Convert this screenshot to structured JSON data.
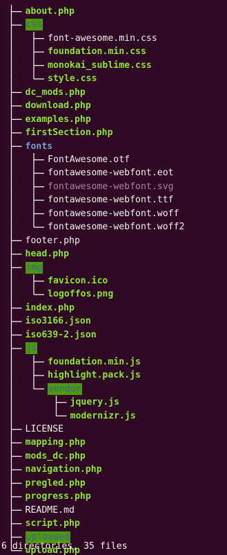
{
  "terminal": {
    "summary": "6 directories, 35 files",
    "colors": {
      "background": "#300a24",
      "executable": "#8ae234",
      "directory": "#729fcf",
      "directory_highlight_bg": "#4e9a06",
      "directory_highlight_fg": "#3465a4",
      "plain": "#eeeeec",
      "image_like": "#ad7fa8",
      "tree_lines": "#eeeeec"
    },
    "entries": [
      {
        "name": "about.php",
        "depth": 0,
        "style": "green",
        "last": false,
        "ancestors_last": []
      },
      {
        "name": "css",
        "depth": 0,
        "style": "dir-hl",
        "last": false,
        "ancestors_last": []
      },
      {
        "name": "font-awesome.min.css",
        "depth": 1,
        "style": "white",
        "last": false,
        "ancestors_last": [
          false
        ]
      },
      {
        "name": "foundation.min.css",
        "depth": 1,
        "style": "green",
        "last": false,
        "ancestors_last": [
          false
        ]
      },
      {
        "name": "monokai_sublime.css",
        "depth": 1,
        "style": "green",
        "last": false,
        "ancestors_last": [
          false
        ]
      },
      {
        "name": "style.css",
        "depth": 1,
        "style": "green",
        "last": true,
        "ancestors_last": [
          false
        ]
      },
      {
        "name": "dc_mods.php",
        "depth": 0,
        "style": "green",
        "last": false,
        "ancestors_last": []
      },
      {
        "name": "download.php",
        "depth": 0,
        "style": "green",
        "last": false,
        "ancestors_last": []
      },
      {
        "name": "examples.php",
        "depth": 0,
        "style": "green",
        "last": false,
        "ancestors_last": []
      },
      {
        "name": "firstSection.php",
        "depth": 0,
        "style": "green",
        "last": false,
        "ancestors_last": []
      },
      {
        "name": "fonts",
        "depth": 0,
        "style": "dir",
        "last": false,
        "ancestors_last": []
      },
      {
        "name": "FontAwesome.otf",
        "depth": 1,
        "style": "white",
        "last": false,
        "ancestors_last": [
          false
        ]
      },
      {
        "name": "fontawesome-webfont.eot",
        "depth": 1,
        "style": "white",
        "last": false,
        "ancestors_last": [
          false
        ]
      },
      {
        "name": "fontawesome-webfont.svg",
        "depth": 1,
        "style": "purple",
        "last": false,
        "ancestors_last": [
          false
        ]
      },
      {
        "name": "fontawesome-webfont.ttf",
        "depth": 1,
        "style": "white",
        "last": false,
        "ancestors_last": [
          false
        ]
      },
      {
        "name": "fontawesome-webfont.woff",
        "depth": 1,
        "style": "white",
        "last": false,
        "ancestors_last": [
          false
        ]
      },
      {
        "name": "fontawesome-webfont.woff2",
        "depth": 1,
        "style": "white",
        "last": true,
        "ancestors_last": [
          false
        ]
      },
      {
        "name": "footer.php",
        "depth": 0,
        "style": "white",
        "last": false,
        "ancestors_last": []
      },
      {
        "name": "head.php",
        "depth": 0,
        "style": "green",
        "last": false,
        "ancestors_last": []
      },
      {
        "name": "img",
        "depth": 0,
        "style": "dir-hl",
        "last": false,
        "ancestors_last": []
      },
      {
        "name": "favicon.ico",
        "depth": 1,
        "style": "green",
        "last": false,
        "ancestors_last": [
          false
        ]
      },
      {
        "name": "logoffos.png",
        "depth": 1,
        "style": "green",
        "last": true,
        "ancestors_last": [
          false
        ]
      },
      {
        "name": "index.php",
        "depth": 0,
        "style": "green",
        "last": false,
        "ancestors_last": []
      },
      {
        "name": "iso3166.json",
        "depth": 0,
        "style": "green",
        "last": false,
        "ancestors_last": []
      },
      {
        "name": "iso639-2.json",
        "depth": 0,
        "style": "green",
        "last": false,
        "ancestors_last": []
      },
      {
        "name": "js",
        "depth": 0,
        "style": "dir-hl",
        "last": false,
        "ancestors_last": []
      },
      {
        "name": "foundation.min.js",
        "depth": 1,
        "style": "green",
        "last": false,
        "ancestors_last": [
          false
        ]
      },
      {
        "name": "highlight.pack.js",
        "depth": 1,
        "style": "green",
        "last": false,
        "ancestors_last": [
          false
        ]
      },
      {
        "name": "vendor",
        "depth": 1,
        "style": "dir-hl",
        "last": true,
        "ancestors_last": [
          false
        ]
      },
      {
        "name": "jquery.js",
        "depth": 2,
        "style": "green",
        "last": false,
        "ancestors_last": [
          false,
          true
        ]
      },
      {
        "name": "modernizr.js",
        "depth": 2,
        "style": "green",
        "last": true,
        "ancestors_last": [
          false,
          true
        ]
      },
      {
        "name": "LICENSE",
        "depth": 0,
        "style": "white",
        "last": false,
        "ancestors_last": []
      },
      {
        "name": "mapping.php",
        "depth": 0,
        "style": "green",
        "last": false,
        "ancestors_last": []
      },
      {
        "name": "mods_dc.php",
        "depth": 0,
        "style": "green",
        "last": false,
        "ancestors_last": []
      },
      {
        "name": "navigation.php",
        "depth": 0,
        "style": "green",
        "last": false,
        "ancestors_last": []
      },
      {
        "name": "pregled.php",
        "depth": 0,
        "style": "green",
        "last": false,
        "ancestors_last": []
      },
      {
        "name": "progress.php",
        "depth": 0,
        "style": "green",
        "last": false,
        "ancestors_last": []
      },
      {
        "name": "README.md",
        "depth": 0,
        "style": "white",
        "last": false,
        "ancestors_last": []
      },
      {
        "name": "script.php",
        "depth": 0,
        "style": "green",
        "last": false,
        "ancestors_last": []
      },
      {
        "name": "uploaded",
        "depth": 0,
        "style": "dir-hl",
        "last": false,
        "ancestors_last": []
      },
      {
        "name": "upload.php",
        "depth": 0,
        "style": "green",
        "last": true,
        "ancestors_last": []
      }
    ]
  }
}
